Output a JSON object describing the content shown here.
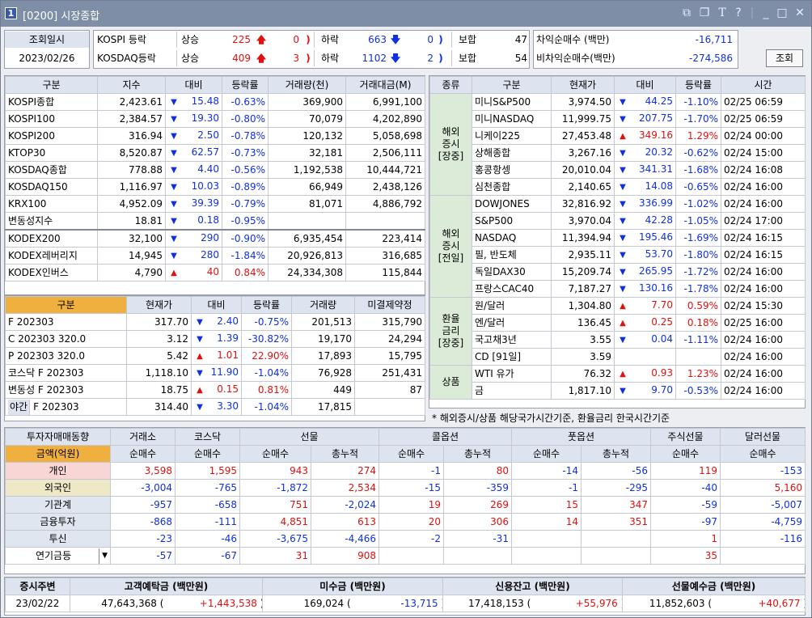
{
  "window": {
    "num": "1",
    "title": "[0200] 시장종합"
  },
  "header": {
    "date_label": "조회일시",
    "date": "2023/02/26",
    "rows": [
      {
        "name": "KOSPI 등락",
        "up_label": "상승",
        "up": "225",
        "up_lim": "0",
        "down_label": "하락",
        "down": "663",
        "down_lim": "0",
        "flat_label": "보합",
        "flat": "47"
      },
      {
        "name": "KOSDAQ등락",
        "up_label": "상승",
        "up": "409",
        "up_lim": "3",
        "down_label": "하락",
        "down": "1102",
        "down_lim": "2",
        "flat_label": "보합",
        "flat": "54"
      }
    ],
    "arb": [
      {
        "label": "차익순매수 (백만)",
        "value": "-16,711"
      },
      {
        "label": "비차익순매수(백만)",
        "value": "-274,586"
      }
    ],
    "search_button": "조회"
  },
  "index_table": {
    "headers": [
      "구분",
      "지수",
      "대비",
      "등락률",
      "거래량(천)",
      "거래대금(M)"
    ],
    "rows": [
      {
        "name": "KOSPI종합",
        "val": "2,423.61",
        "dir": "dn",
        "chg": "15.48",
        "rate": "-0.63%",
        "vol": "369,900",
        "amt": "6,991,100"
      },
      {
        "name": "KOSPI100",
        "val": "2,384.57",
        "dir": "dn",
        "chg": "19.30",
        "rate": "-0.80%",
        "vol": "70,079",
        "amt": "4,202,890"
      },
      {
        "name": "KOSPI200",
        "val": "316.94",
        "dir": "dn",
        "chg": "2.50",
        "rate": "-0.78%",
        "vol": "120,132",
        "amt": "5,058,698"
      },
      {
        "name": "KTOP30",
        "val": "8,520.87",
        "dir": "dn",
        "chg": "62.57",
        "rate": "-0.73%",
        "vol": "32,181",
        "amt": "2,506,111"
      },
      {
        "name": "KOSDAQ종합",
        "val": "778.88",
        "dir": "dn",
        "chg": "4.40",
        "rate": "-0.56%",
        "vol": "1,192,538",
        "amt": "10,444,721"
      },
      {
        "name": "KOSDAQ150",
        "val": "1,116.97",
        "dir": "dn",
        "chg": "10.03",
        "rate": "-0.89%",
        "vol": "66,949",
        "amt": "2,438,126"
      },
      {
        "name": "KRX100",
        "val": "4,952.09",
        "dir": "dn",
        "chg": "39.39",
        "rate": "-0.79%",
        "vol": "81,071",
        "amt": "4,886,792"
      },
      {
        "name": "변동성지수",
        "val": "18.81",
        "dir": "dn",
        "chg": "0.18",
        "rate": "-0.95%",
        "vol": "",
        "amt": ""
      },
      {
        "name": "KODEX200",
        "val": "32,100",
        "dir": "dn",
        "chg": "290",
        "rate": "-0.90%",
        "vol": "6,935,454",
        "amt": "223,414"
      },
      {
        "name": "KODEX레버리지",
        "val": "14,945",
        "dir": "dn",
        "chg": "280",
        "rate": "-1.84%",
        "vol": "20,926,813",
        "amt": "316,685"
      },
      {
        "name": "KODEX인버스",
        "val": "4,790",
        "dir": "up",
        "chg": "40",
        "rate": "0.84%",
        "vol": "24,334,308",
        "amt": "115,844"
      }
    ]
  },
  "futures_table": {
    "headers": [
      "구분",
      "현재가",
      "대비",
      "등락률",
      "거래량",
      "미결제약정"
    ],
    "rows": [
      {
        "name": "F 202303",
        "val": "317.70",
        "dir": "dn",
        "chg": "2.40",
        "rate": "-0.75%",
        "vol": "201,513",
        "oi": "315,790"
      },
      {
        "name": "C 202303 320.0",
        "val": "3.12",
        "dir": "dn",
        "chg": "1.39",
        "rate": "-30.82%",
        "vol": "19,170",
        "oi": "24,294"
      },
      {
        "name": "P 202303 320.0",
        "val": "5.42",
        "dir": "up",
        "chg": "1.01",
        "rate": "22.90%",
        "vol": "17,893",
        "oi": "15,795"
      },
      {
        "name": "코스닥 F 202303",
        "val": "1,118.10",
        "dir": "dn",
        "chg": "11.90",
        "rate": "-1.04%",
        "vol": "76,928",
        "oi": "251,431"
      },
      {
        "name": "변동성 F 202303",
        "val": "18.75",
        "dir": "up",
        "chg": "0.15",
        "rate": "0.81%",
        "vol": "449",
        "oi": "87"
      }
    ],
    "night": {
      "label": "야간",
      "name": "F 202303",
      "val": "314.40",
      "dir": "dn",
      "chg": "3.30",
      "rate": "-1.04%",
      "vol": "17,815",
      "oi": ""
    }
  },
  "global_table": {
    "headers": [
      "종류",
      "구분",
      "현재가",
      "대비",
      "등락률",
      "시간"
    ],
    "groups": [
      {
        "label": "해외\n증시\n[장중]",
        "rows": [
          {
            "name": "미니S&P500",
            "val": "3,974.50",
            "dir": "dn",
            "chg": "44.25",
            "rate": "-1.10%",
            "time": "02/25 06:59"
          },
          {
            "name": "미니NASDAQ",
            "val": "11,999.75",
            "dir": "dn",
            "chg": "207.75",
            "rate": "-1.70%",
            "time": "02/25 06:59"
          },
          {
            "name": "니케이225",
            "val": "27,453.48",
            "dir": "up",
            "chg": "349.16",
            "rate": "1.29%",
            "time": "02/24 00:00"
          },
          {
            "name": "상해종합",
            "val": "3,267.16",
            "dir": "dn",
            "chg": "20.32",
            "rate": "-0.62%",
            "time": "02/24 15:00"
          },
          {
            "name": "홍콩항셍",
            "val": "20,010.04",
            "dir": "dn",
            "chg": "341.31",
            "rate": "-1.68%",
            "time": "02/24 16:08"
          },
          {
            "name": "심천종합",
            "val": "2,140.65",
            "dir": "dn",
            "chg": "14.08",
            "rate": "-0.65%",
            "time": "02/24 16:00"
          }
        ]
      },
      {
        "label": "해외\n증시\n[전일]",
        "rows": [
          {
            "name": "DOWJONES",
            "val": "32,816.92",
            "dir": "dn",
            "chg": "336.99",
            "rate": "-1.02%",
            "time": "02/24 16:00"
          },
          {
            "name": "S&P500",
            "val": "3,970.04",
            "dir": "dn",
            "chg": "42.28",
            "rate": "-1.05%",
            "time": "02/24 17:00"
          },
          {
            "name": "NASDAQ",
            "val": "11,394.94",
            "dir": "dn",
            "chg": "195.46",
            "rate": "-1.69%",
            "time": "02/24 16:15"
          },
          {
            "name": "필, 반도체",
            "val": "2,935.11",
            "dir": "dn",
            "chg": "53.70",
            "rate": "-1.80%",
            "time": "02/24 16:15"
          },
          {
            "name": "독일DAX30",
            "val": "15,209.74",
            "dir": "dn",
            "chg": "265.95",
            "rate": "-1.72%",
            "time": "02/24 16:00"
          },
          {
            "name": "프랑스CAC40",
            "val": "7,187.27",
            "dir": "dn",
            "chg": "130.16",
            "rate": "-1.78%",
            "time": "02/24 16:00"
          }
        ]
      },
      {
        "label": "환율\n금리\n[장중]",
        "rows": [
          {
            "name": "원/달러",
            "val": "1,304.80",
            "dir": "up",
            "chg": "7.70",
            "rate": "0.59%",
            "time": "02/24 15:30"
          },
          {
            "name": "엔/달러",
            "val": "136.45",
            "dir": "up",
            "chg": "0.25",
            "rate": "0.18%",
            "time": "02/25 16:00"
          },
          {
            "name": "국고채3년",
            "val": "3.55",
            "dir": "dn",
            "chg": "0.04",
            "rate": "-1.11%",
            "time": "02/24 16:00"
          },
          {
            "name": "CD [91일]",
            "val": "3.59",
            "dir": "",
            "chg": "",
            "rate": "",
            "time": "02/24 16:00"
          }
        ]
      },
      {
        "label": "상품",
        "rows": [
          {
            "name": "WTI 유가",
            "val": "76.32",
            "dir": "up",
            "chg": "0.93",
            "rate": "1.23%",
            "time": "02/24 16:00"
          },
          {
            "name": "금",
            "val": "1,817.10",
            "dir": "dn",
            "chg": "9.70",
            "rate": "-0.53%",
            "time": "02/24 16:00"
          }
        ]
      }
    ],
    "note": "* 해외증시/상품 해당국가시간기준, 환율금리 한국시간기준"
  },
  "investor_table": {
    "title": "투자자매매동향",
    "unit": "금액(억원)",
    "col_groups": [
      "거래소",
      "코스닥",
      "선물",
      "콜옵션",
      "풋옵션",
      "주식선물",
      "달러선물"
    ],
    "sub_headers": [
      "순매수",
      "순매수",
      "순매수",
      "총누적",
      "순매수",
      "총누적",
      "순매수",
      "총누적",
      "순매수",
      "순매수"
    ],
    "rows": [
      {
        "name": "개인",
        "vals": [
          "3,598",
          "1,595",
          "943",
          "274",
          "-1",
          "80",
          "-14",
          "-56",
          "119",
          "-153"
        ]
      },
      {
        "name": "외국인",
        "vals": [
          "-3,004",
          "-765",
          "-1,872",
          "2,534",
          "-15",
          "-359",
          "-1",
          "-295",
          "-40",
          "5,160"
        ]
      },
      {
        "name": "기관계",
        "vals": [
          "-957",
          "-658",
          "751",
          "-2,024",
          "19",
          "269",
          "15",
          "347",
          "-59",
          "-5,007"
        ]
      },
      {
        "name": "금융투자",
        "vals": [
          "-868",
          "-111",
          "4,851",
          "613",
          "20",
          "306",
          "14",
          "351",
          "-97",
          "-4,759"
        ]
      },
      {
        "name": "투신",
        "vals": [
          "-23",
          "-46",
          "-3,675",
          "-4,466",
          "-2",
          "-31",
          "",
          "",
          "1",
          "-116"
        ]
      },
      {
        "name": "연기금등",
        "vals": [
          "-57",
          "-67",
          "31",
          "908",
          "",
          "",
          "",
          "",
          "35",
          ""
        ]
      }
    ]
  },
  "summary": {
    "headers": [
      "증시주변",
      "고객예탁금 (백만원)",
      "미수금 (백만원)",
      "신용잔고 (백만원)",
      "선물예수금 (백만원)"
    ],
    "date": "23/02/22",
    "items": [
      {
        "v": "47,643,368",
        "d": "+1,443,538"
      },
      {
        "v": "169,024",
        "d": "-13,715"
      },
      {
        "v": "17,418,153",
        "d": "+55,976"
      },
      {
        "v": "11,852,603",
        "d": "+40,677"
      }
    ]
  },
  "colors": {
    "title": "#7d8ea6",
    "header": "#dde3ef",
    "group": "#dcebd8",
    "unit": "#f0b040",
    "indiv": "#f8d6d6",
    "foreign": "#efe8c6",
    "inst": "#e0e6ef",
    "up": "#e01010",
    "down": "#1030e0"
  }
}
